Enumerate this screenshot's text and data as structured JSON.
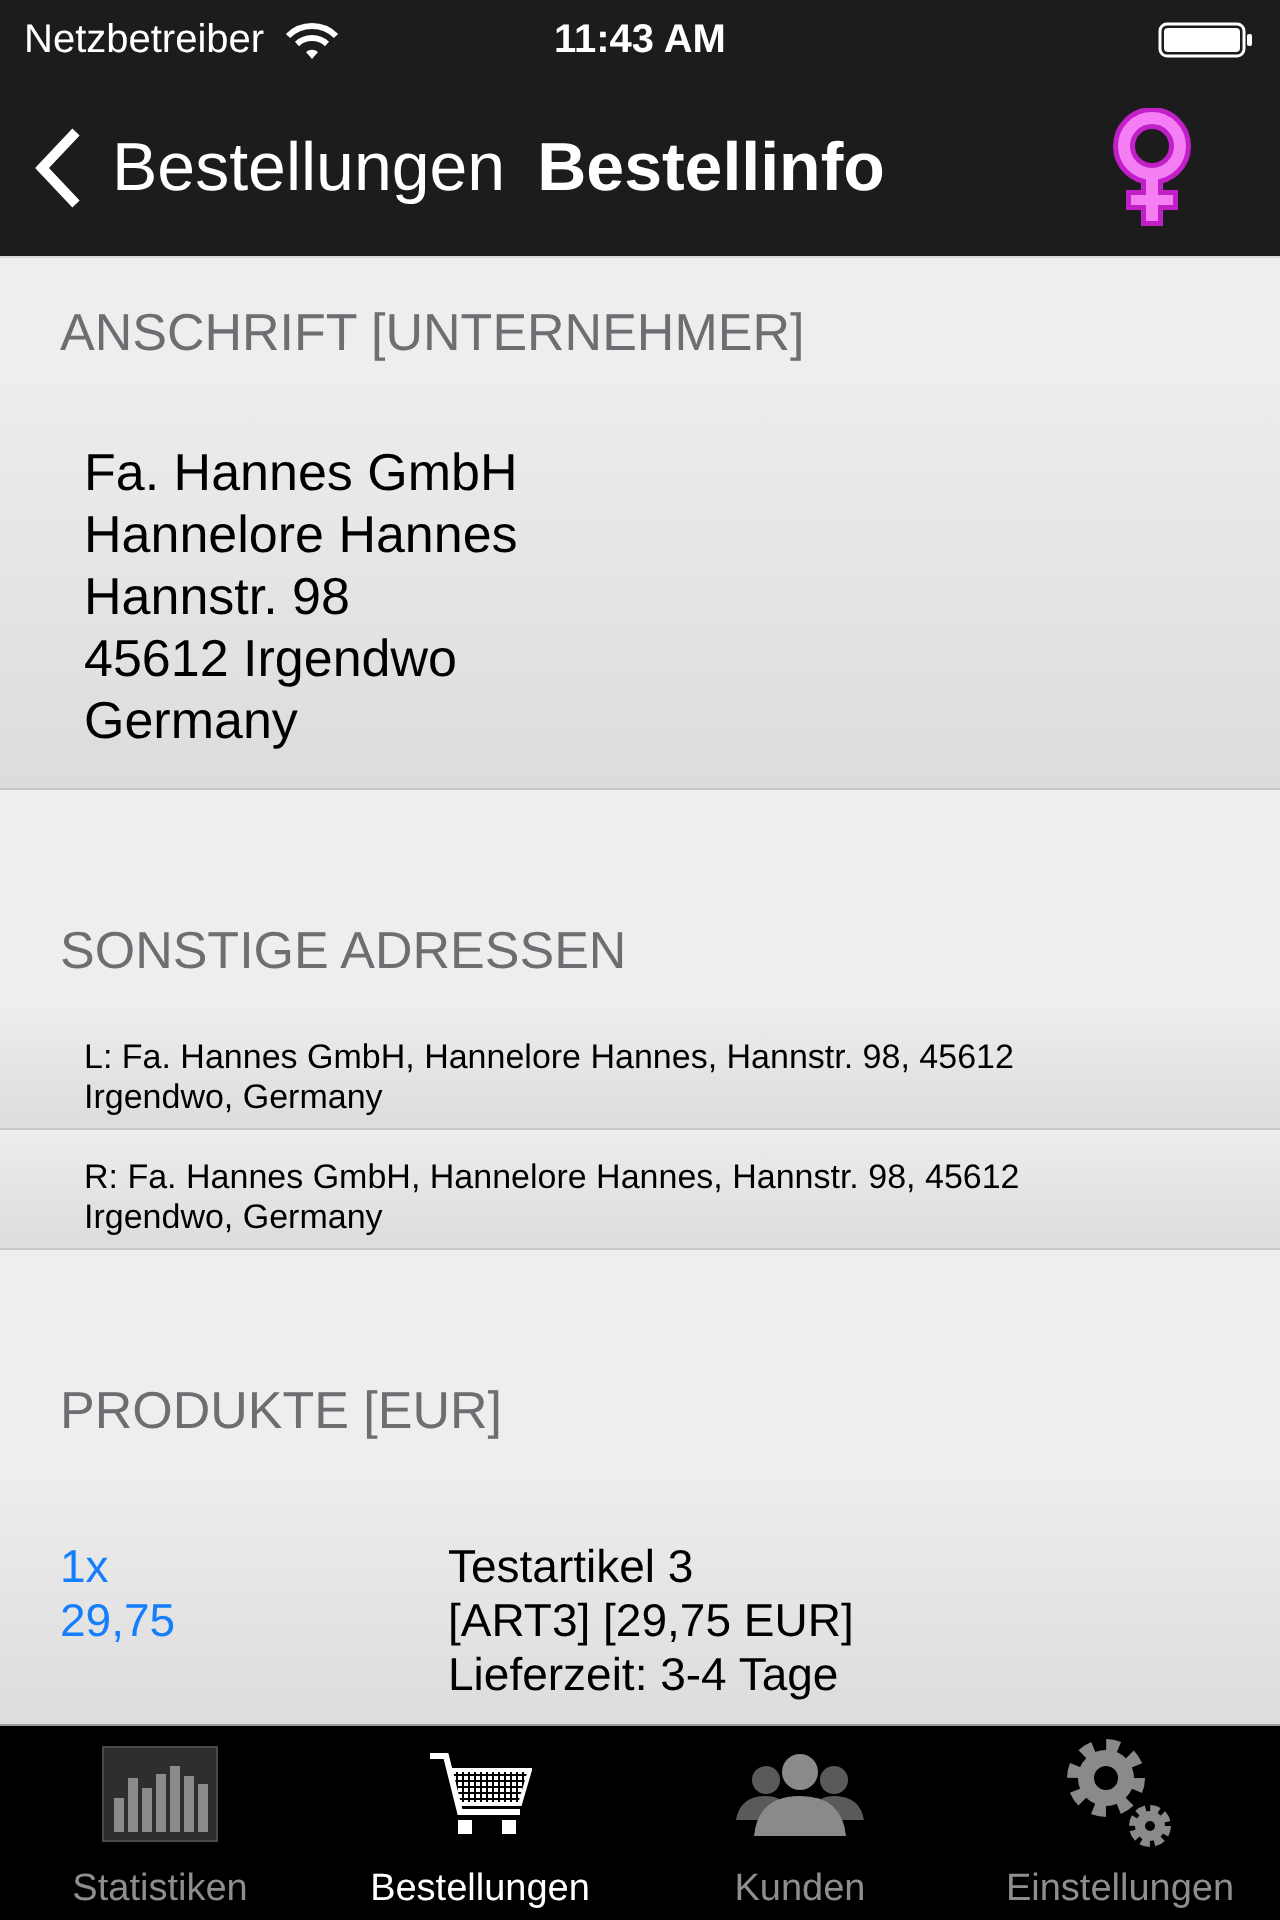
{
  "status_bar": {
    "carrier": "Netzbetreiber",
    "time": "11:43 AM"
  },
  "nav_bar": {
    "back_label": "Bestellungen",
    "title": "Bestellinfo"
  },
  "sections": [
    {
      "kind": "address",
      "header": "ANSCHRIFT [UNTERNEHMER]",
      "lines": [
        "Fa. Hannes GmbH",
        "Hannelore Hannes",
        "Hannstr. 98",
        "45612 Irgendwo",
        "Germany"
      ]
    },
    {
      "kind": "other_addresses",
      "header": "SONSTIGE ADRESSEN",
      "rows": [
        "L: Fa. Hannes GmbH, Hannelore Hannes, Hannstr. 98, 45612 Irgendwo, Germany",
        "R: Fa. Hannes GmbH, Hannelore Hannes, Hannstr. 98, 45612 Irgendwo, Germany"
      ]
    },
    {
      "kind": "products",
      "header": "PRODUKTE [EUR]",
      "items": [
        {
          "quantity": "1x",
          "price": "29,75",
          "lines": [
            "Testartikel 3",
            "[ART3] [29,75 EUR]",
            "Lieferzeit: 3-4 Tage"
          ]
        }
      ]
    }
  ],
  "tab_bar": {
    "tabs": [
      {
        "kind": "chart",
        "label": "Statistiken",
        "selected": false
      },
      {
        "kind": "cart",
        "label": "Bestellungen",
        "selected": true
      },
      {
        "kind": "people",
        "label": "Kunden",
        "selected": false
      },
      {
        "kind": "gears",
        "label": "Einstellungen",
        "selected": false
      }
    ]
  }
}
